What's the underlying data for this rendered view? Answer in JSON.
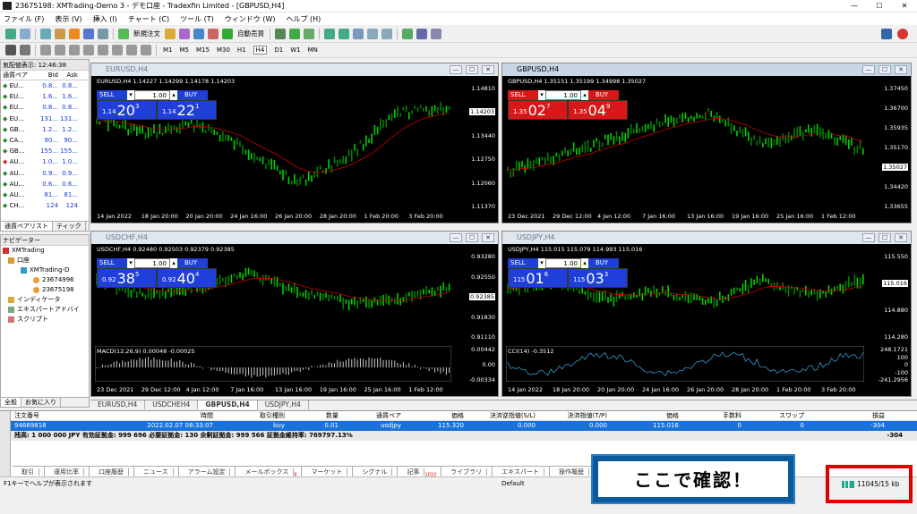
{
  "app": {
    "title": "23675198: XMTrading-Demo 3 - デモ口座 - Tradexfin Limited - [GBPUSD,H4]"
  },
  "menu": [
    "ファイル (F)",
    "表示 (V)",
    "挿入 (I)",
    "チャート (C)",
    "ツール (T)",
    "ウィンドウ (W)",
    "ヘルプ (H)"
  ],
  "toolbar": {
    "new_order": "新規注文",
    "auto_trade": "自動売買",
    "timeframes": [
      "M1",
      "M5",
      "M15",
      "M30",
      "H1",
      "H4",
      "D1",
      "W1",
      "MN"
    ],
    "selected_tf": "H4"
  },
  "market_watch": {
    "title": "気配値表示: 12:46:38",
    "cols": [
      "通貨ペア",
      "Bid",
      "Ask"
    ],
    "rows": [
      [
        "EU...",
        "0.8...",
        "0.8..."
      ],
      [
        "EU...",
        "1.6...",
        "1.6..."
      ],
      [
        "EU...",
        "0.8...",
        "0.8..."
      ],
      [
        "EU...",
        "131...",
        "131..."
      ],
      [
        "GB...",
        "1.2...",
        "1.2..."
      ],
      [
        "CA...",
        "90...",
        "90..."
      ],
      [
        "GB...",
        "155...",
        "155..."
      ],
      [
        "AU...",
        "1.0...",
        "1.0..."
      ],
      [
        "AU...",
        "0.9...",
        "0.9..."
      ],
      [
        "AU...",
        "0.6...",
        "0.6..."
      ],
      [
        "AU...",
        "81...",
        "81..."
      ],
      [
        "CH...",
        "124",
        "124"
      ]
    ],
    "tabs": [
      "通貨ペアリスト",
      "ティック"
    ]
  },
  "navigator": {
    "title": "ナビゲーター",
    "items": [
      "XMTrading",
      "口座",
      "XMTrading-D",
      "23674996",
      "23675198",
      "インディケータ",
      "エキスパートアドバイ",
      "スクリプト"
    ],
    "tabs": [
      "全般",
      "お気に入り"
    ]
  },
  "charts": [
    {
      "caption": "EURUSD,H4",
      "info": "EURUSD,H4  1.14227 1.14299 1.14178 1.14203",
      "lot": "1.00",
      "sell": {
        "small": "1.14",
        "big": "20",
        "sup": "3"
      },
      "buy": {
        "small": "1.14",
        "big": "22",
        "sup": "1"
      },
      "color": "blue",
      "y_ticks": [
        "1.14810",
        "1.14203",
        "1.13440",
        "1.12750",
        "1.12060",
        "1.11370"
      ],
      "x_ticks": [
        "14 Jan 2022",
        "18 Jan 20:00",
        "20 Jan 20:00",
        "24 Jan 16:00",
        "26 Jan 20:00",
        "28 Jan 20:00",
        "1 Feb 20:00",
        "3 Feb 20:00"
      ],
      "current": "1.14203"
    },
    {
      "caption": "GBPUSD,H4",
      "info": "GBPUSD,H4  1.35151 1.35199 1.34998 1.35027",
      "lot": "1.00",
      "sell": {
        "small": "1.35",
        "big": "02",
        "sup": "7"
      },
      "buy": {
        "small": "1.35",
        "big": "04",
        "sup": "9"
      },
      "color": "red",
      "y_ticks": [
        "1.37450",
        "1.36700",
        "1.35935",
        "1.35170",
        "1.35027",
        "1.34420",
        "1.33655"
      ],
      "x_ticks": [
        "23 Dec 2021",
        "29 Dec 12:00",
        "4 Jan 12:00",
        "7 Jan 16:00",
        "13 Jan 16:00",
        "19 Jan 16:00",
        "25 Jan 16:00",
        "1 Feb 12:00"
      ],
      "current": "1.35027"
    },
    {
      "caption": "USDCHF,H4",
      "info": "USDCHF,H4  0.92480 0.92503 0.92379 0.92385",
      "lot": "1.00",
      "sell": {
        "small": "0.92",
        "big": "38",
        "sup": "5"
      },
      "buy": {
        "small": "0.92",
        "big": "40",
        "sup": "4"
      },
      "color": "blue",
      "y_ticks": [
        "0.93280",
        "0.92550",
        "0.92385",
        "0.91830",
        "0.91110"
      ],
      "sub_info": "MACD(12,26,9) 0.00048 -0.00025",
      "sub_ticks": [
        "0.00442",
        "0.00",
        "-0.00334"
      ],
      "x_ticks": [
        "23 Dec 2021",
        "29 Dec 12:00",
        "4 Jan 12:00",
        "7 Jan 16:00",
        "13 Jan 16:00",
        "19 Jan 16:00",
        "25 Jan 16:00",
        "1 Feb 12:00"
      ],
      "current": "0.92385"
    },
    {
      "caption": "USDJPY,H4",
      "info": "USDJPY,H4  115.015 115.079 114.993 115.016",
      "lot": "1.00",
      "sell": {
        "small": "115",
        "big": "01",
        "sup": "6"
      },
      "buy": {
        "small": "115",
        "big": "03",
        "sup": "3"
      },
      "color": "blue",
      "y_ticks": [
        "115.550",
        "115.016",
        "114.880",
        "114.280"
      ],
      "sub_info": "CCI(14) -0.3512",
      "sub_ticks": [
        "248.1721",
        "100",
        "0",
        "-100",
        "-241.2956"
      ],
      "x_ticks": [
        "14 Jan 2022",
        "18 Jan 20:00",
        "20 Jan 20:00",
        "24 Jan 16:00",
        "26 Jan 20:00",
        "28 Jan 20:00",
        "1 Feb 20:00",
        "3 Feb 20:00"
      ],
      "current": "115.016"
    }
  ],
  "chart_tabs": [
    "EURUSD,H4",
    "USDCHEH4",
    "GBPUSD,H4",
    "USDJPY,H4"
  ],
  "terminal": {
    "headers": [
      "注文番号",
      "時間",
      "取引種別",
      "数量",
      "通貨ペア",
      "価格",
      "決済逆指値(S/L)",
      "決済指値(T/P)",
      "価格",
      "手数料",
      "スワップ",
      "損益"
    ],
    "row": [
      "94669818",
      "2022.02.07 08:33:07",
      "buy",
      "0.01",
      "usdjpy",
      "115.320",
      "0.000",
      "0.000",
      "115.016",
      "0",
      "0",
      "-304"
    ],
    "balance": "残高: 1 000 000 JPY  有効証拠金: 999 696  必要証拠金: 130  余剰証拠金: 999 566  証拠金維持率: 769797.13%",
    "balance_pl": "-304",
    "tabs": [
      "取引",
      "運用比率",
      "口座履歴",
      "ニュース",
      "アラーム設定",
      "メールボックス",
      "マーケット",
      "シグナル",
      "記事",
      "ライブラリ",
      "エキスパート",
      "操作履歴"
    ],
    "mail_badge": "8",
    "article_badge": "1010"
  },
  "status": {
    "help": "F1キーでヘルプが表示されます",
    "profile": "Default",
    "traffic": "11045/15 kb"
  },
  "callout": "ここで確認！"
}
